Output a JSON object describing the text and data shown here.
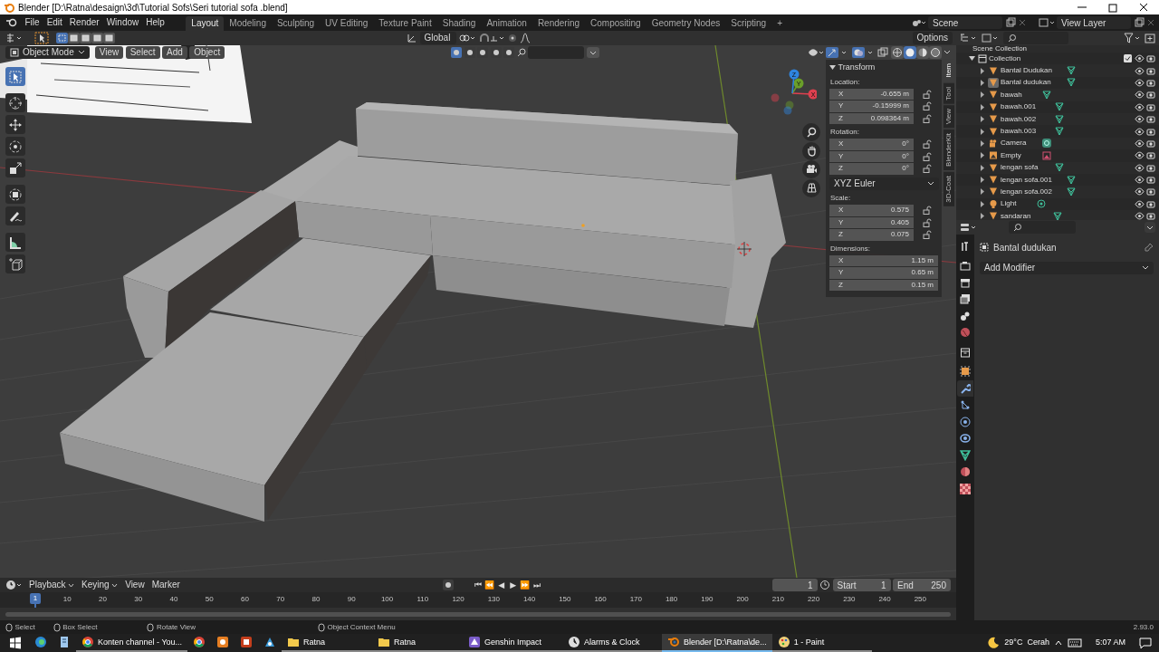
{
  "window": {
    "title": "Blender [D:\\Ratna\\desaign\\3d\\Tutorial Sofs\\Seri tutorial sofa .blend]"
  },
  "menu": [
    "File",
    "Edit",
    "Render",
    "Window",
    "Help"
  ],
  "workspaces": [
    {
      "label": "Layout",
      "selected": true
    },
    {
      "label": "Modeling",
      "selected": false
    },
    {
      "label": "Sculpting",
      "selected": false
    },
    {
      "label": "UV Editing",
      "selected": false
    },
    {
      "label": "Texture Paint",
      "selected": false
    },
    {
      "label": "Shading",
      "selected": false
    },
    {
      "label": "Animation",
      "selected": false
    },
    {
      "label": "Rendering",
      "selected": false
    },
    {
      "label": "Compositing",
      "selected": false
    },
    {
      "label": "Geometry Nodes",
      "selected": false
    },
    {
      "label": "Scripting",
      "selected": false
    }
  ],
  "add_workspace": "+",
  "scene": "Scene",
  "view_layer": "View Layer",
  "viewport": {
    "orientation": "Global",
    "options": "Options",
    "mode": "Object Mode",
    "menus": [
      "View",
      "Select",
      "Add",
      "Object"
    ],
    "select_modes": [
      {
        "selected": true
      },
      {
        "selected": false
      },
      {
        "selected": false
      },
      {
        "selected": false
      },
      {
        "selected": false
      }
    ],
    "shading": [
      {
        "kind": "wireframe",
        "selected": false
      },
      {
        "kind": "solid",
        "selected": true
      },
      {
        "kind": "material",
        "selected": false
      },
      {
        "kind": "rendered",
        "selected": false
      }
    ],
    "tools": [
      {
        "kind": "select",
        "selected": true
      },
      {
        "kind": "cursor",
        "selected": false
      },
      {
        "kind": "move",
        "selected": false
      },
      {
        "kind": "rotate",
        "selected": false
      },
      {
        "kind": "scale",
        "selected": false
      },
      {
        "kind": "transform",
        "selected": false
      },
      {
        "kind": "annotate",
        "selected": false
      },
      {
        "kind": "measure",
        "selected": false
      },
      {
        "kind": "add_cube",
        "selected": false
      }
    ],
    "gizmo": [
      {
        "axis": "X",
        "color": "#e0404f"
      },
      {
        "axis": "Y",
        "color": "#6a9f2a"
      },
      {
        "axis": "Z",
        "color": "#2f85e0"
      }
    ]
  },
  "n_panel": {
    "tabs": [
      {
        "label": "Item",
        "selected": true
      },
      {
        "label": "Tool",
        "selected": false
      },
      {
        "label": "View",
        "selected": false
      },
      {
        "label": "BlenderKit",
        "selected": false
      },
      {
        "label": "3D-Coat",
        "selected": false
      }
    ],
    "title": "Transform",
    "groups": [
      {
        "label": "Location:",
        "fields": [
          {
            "axis": "X",
            "value": "-0.655 m",
            "locked": false
          },
          {
            "axis": "Y",
            "value": "-0.15999 m",
            "locked": false
          },
          {
            "axis": "Z",
            "value": "0.098364 m",
            "locked": false
          }
        ]
      },
      {
        "label": "Rotation:",
        "fields": [
          {
            "axis": "X",
            "value": "0°",
            "locked": false
          },
          {
            "axis": "Y",
            "value": "0°",
            "locked": false
          },
          {
            "axis": "Z",
            "value": "0°",
            "locked": false
          }
        ],
        "mode": "XYZ Euler"
      },
      {
        "label": "Scale:",
        "fields": [
          {
            "axis": "X",
            "value": "0.575",
            "locked": false
          },
          {
            "axis": "Y",
            "value": "0.405",
            "locked": false
          },
          {
            "axis": "Z",
            "value": "0.075",
            "locked": false
          }
        ]
      },
      {
        "label": "Dimensions:",
        "fields": [
          {
            "axis": "X",
            "value": "1.15 m"
          },
          {
            "axis": "Y",
            "value": "0.65 m"
          },
          {
            "axis": "Z",
            "value": "0.15 m"
          }
        ]
      }
    ]
  },
  "outliner": {
    "scene_collection": "Scene Collection",
    "collection": {
      "name": "Collection",
      "checked": true
    },
    "items": [
      {
        "name": "Bantal Dudukan",
        "kind": "mesh",
        "active": false
      },
      {
        "name": "Bantal dudukan",
        "kind": "mesh",
        "active": true
      },
      {
        "name": "bawah",
        "kind": "mesh",
        "active": false
      },
      {
        "name": "bawah.001",
        "kind": "mesh",
        "active": false
      },
      {
        "name": "bawah.002",
        "kind": "mesh",
        "active": false
      },
      {
        "name": "bawah.003",
        "kind": "mesh",
        "active": false
      },
      {
        "name": "Camera",
        "kind": "camera",
        "active": false
      },
      {
        "name": "Empty",
        "kind": "empty",
        "active": false
      },
      {
        "name": "lengan sofa",
        "kind": "mesh",
        "active": false
      },
      {
        "name": "lengan sofa.001",
        "kind": "mesh",
        "active": false
      },
      {
        "name": "lengan sofa.002",
        "kind": "mesh",
        "active": false
      },
      {
        "name": "Light",
        "kind": "light",
        "active": false
      },
      {
        "name": "sandaran",
        "kind": "mesh",
        "active": false
      }
    ]
  },
  "properties": {
    "tabs": [
      {
        "kind": "tool",
        "selected": false
      },
      {
        "kind": "render",
        "selected": false
      },
      {
        "kind": "output",
        "selected": false
      },
      {
        "kind": "view_layer",
        "selected": false
      },
      {
        "kind": "scene",
        "selected": false
      },
      {
        "kind": "world",
        "selected": false
      },
      {
        "kind": "collection",
        "selected": false
      },
      {
        "kind": "object",
        "selected": false
      },
      {
        "kind": "modifier",
        "selected": true
      },
      {
        "kind": "particles",
        "selected": false
      },
      {
        "kind": "physics",
        "selected": false
      },
      {
        "kind": "constraints",
        "selected": false
      },
      {
        "kind": "data",
        "selected": false
      },
      {
        "kind": "material",
        "selected": false
      },
      {
        "kind": "texture",
        "selected": false
      }
    ],
    "object": "Bantal dudukan",
    "add_modifier": "Add Modifier"
  },
  "timeline": {
    "menus": [
      {
        "label": "Playback",
        "dropdown": true
      },
      {
        "label": "Keying",
        "dropdown": true
      },
      {
        "label": "View",
        "dropdown": false
      },
      {
        "label": "Marker",
        "dropdown": false
      }
    ],
    "transport": [
      "⏮",
      "⏪",
      "◀",
      "▶",
      "⏩",
      "⏭"
    ],
    "current_frame": "1",
    "start_label": "Start",
    "start": "1",
    "end_label": "End",
    "end": "250",
    "playhead": "1",
    "ruler": [
      "10",
      "20",
      "30",
      "40",
      "50",
      "60",
      "70",
      "80",
      "90",
      "100",
      "110",
      "120",
      "130",
      "140",
      "150",
      "160",
      "170",
      "180",
      "190",
      "200",
      "210",
      "220",
      "230",
      "240",
      "250"
    ]
  },
  "status_bar": {
    "hints": [
      "Select",
      "Box Select",
      "Rotate View",
      "Object Context Menu"
    ],
    "version": "2.93.0"
  },
  "taskbar": {
    "items": [
      {
        "kind": "edge",
        "selected": false
      },
      {
        "kind": "notes",
        "selected": false
      },
      {
        "kind": "chrome",
        "label": "Konten channel - You...",
        "selected": false
      },
      {
        "kind": "chrome",
        "selected": false
      },
      {
        "kind": "orange",
        "selected": false
      },
      {
        "kind": "powerpoint",
        "selected": false
      },
      {
        "kind": "blue",
        "selected": false
      },
      {
        "kind": "folder",
        "label": "Ratna",
        "selected": false
      },
      {
        "kind": "folder",
        "label": "Ratna",
        "selected": false
      },
      {
        "kind": "game",
        "label": "Genshin Impact",
        "selected": false
      },
      {
        "kind": "clock",
        "label": "Alarms & Clock",
        "selected": false
      },
      {
        "kind": "blender",
        "label": "Blender [D:\\Ratna\\de...",
        "selected": true
      },
      {
        "kind": "paint",
        "label": "1 - Paint",
        "selected": false
      }
    ],
    "weather": "29°C",
    "condition": "Cerah",
    "time": "5:07 AM"
  }
}
